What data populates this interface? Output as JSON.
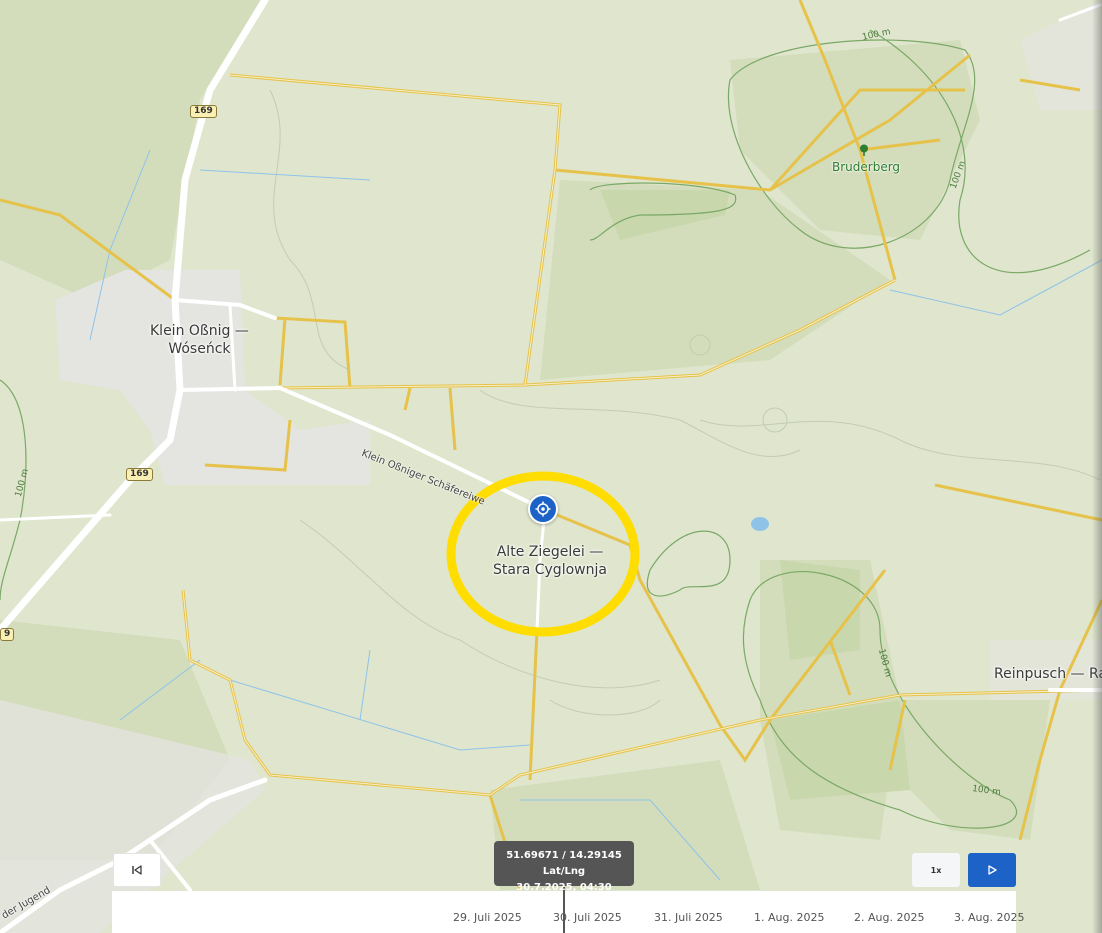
{
  "map": {
    "places": {
      "klein_ossnig": "Klein Oßnig —\nWóseńck",
      "alte_ziegelei": "Alte Ziegelei —\nStara Cyglownja",
      "reinpusch": "Reinpusch — Ra",
      "bruderberg": "Bruderberg"
    },
    "roads": {
      "schaefereiweg": "Klein Oßniger Schäfereiwe",
      "der_jugend": "der Jugend",
      "route_169": "169",
      "route_9": "9"
    },
    "contours": {
      "c1": "100 m",
      "c2": "100 m",
      "c3": "100 m",
      "c4": "100 m",
      "c5": "100 m"
    },
    "icons": {
      "marker": "crosshair-target-icon",
      "peak": "tree-peak-icon"
    },
    "colors": {
      "highlight_ring": "#ffdd00",
      "marker": "#1d63c7",
      "forest": "#c9d7ad",
      "land": "#dfe6cd",
      "track": "#e6c24a",
      "road": "#ffffff",
      "settlement": "#e4e4e0"
    }
  },
  "tooltip": {
    "coords": "51.69671 / 14.29145 Lat/Lng",
    "time": "30.7.2025, 04:30"
  },
  "timeline": {
    "ticks": [
      "29. Juli 2025",
      "30. Juli 2025",
      "31. Juli 2025",
      "1. Aug. 2025",
      "2. Aug. 2025",
      "3. Aug. 2025"
    ]
  },
  "controls": {
    "speed": "1x",
    "start_icon": "skip-to-start-icon",
    "play_icon": "play-icon"
  }
}
